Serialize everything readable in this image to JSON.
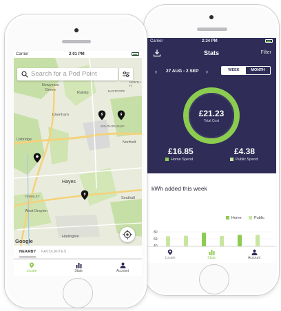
{
  "back_phone": {
    "status_bar": {
      "carrier": "Carrier",
      "time": "2:34 PM"
    },
    "header": {
      "title": "Stats",
      "filter_label": "Filter"
    },
    "date_nav": {
      "range": "27 AUG - 2 SEP",
      "prev": "‹",
      "next": "›"
    },
    "segment": {
      "week": "WEEK",
      "month": "MONTH",
      "selected": "WEEK"
    },
    "total": {
      "value": "£21.23",
      "label": "Total Cost"
    },
    "home_spend": {
      "value": "£16.85",
      "label": "Home Spend"
    },
    "public_spend": {
      "value": "£4.38",
      "label": "Public Spend"
    },
    "kwh_section": {
      "title": "kWh added this week"
    },
    "legend": {
      "home": "Home",
      "public": "Public"
    },
    "chart_data": {
      "type": "bar",
      "y_ticks": [
        "80",
        "60",
        "40"
      ],
      "series": [
        {
          "name": "Home",
          "values": [
            0,
            0,
            71,
            0,
            62,
            0
          ]
        },
        {
          "name": "Public",
          "values": [
            56,
            58,
            0,
            57,
            0,
            62
          ]
        }
      ]
    },
    "tabs": [
      {
        "label": "Locate"
      },
      {
        "label": "Stats"
      },
      {
        "label": "Account"
      }
    ],
    "active_tab": "Stats"
  },
  "front_phone": {
    "status_bar": {
      "carrier": "Carrier",
      "time": "2:01 PM"
    },
    "search": {
      "placeholder": "Search for a Pod Point"
    },
    "map_labels": [
      {
        "text": "Newyears Green",
        "name": "map-label-newyears-green"
      },
      {
        "text": "Ruislip",
        "name": "map-label-ruislip"
      },
      {
        "text": "EASTCOTE",
        "name": "map-label-eastcote"
      },
      {
        "text": "Ickenham",
        "name": "map-label-ickenham"
      },
      {
        "text": "SOUTH RUISLIP",
        "name": "map-label-south-ruislip"
      },
      {
        "text": "Uxbridge",
        "name": "map-label-uxbridge"
      },
      {
        "text": "Northolt",
        "name": "map-label-northolt"
      },
      {
        "text": "Hayes",
        "name": "map-label-hayes"
      },
      {
        "text": "YEWSLEY",
        "name": "map-label-yewsley"
      },
      {
        "text": "Southall",
        "name": "map-label-southall"
      },
      {
        "text": "West Drayton",
        "name": "map-label-west-drayton"
      },
      {
        "text": "Harlington",
        "name": "map-label-harlington"
      },
      {
        "text": "NORTH H",
        "name": "map-label-north-h"
      }
    ],
    "google_logo": "Google",
    "list_tabs": {
      "nearby": "NEARBY",
      "favourites": "FAVOURITES"
    },
    "tabs": [
      {
        "label": "Locate"
      },
      {
        "label": "Stats"
      },
      {
        "label": "Account"
      }
    ],
    "active_tab": "Locate"
  },
  "colors": {
    "navy": "#2f2d57",
    "green": "#8ccc50",
    "light_green": "#c8e6a0",
    "map_bg": "#e9ecdc",
    "park_green": "#c6dfa6"
  }
}
